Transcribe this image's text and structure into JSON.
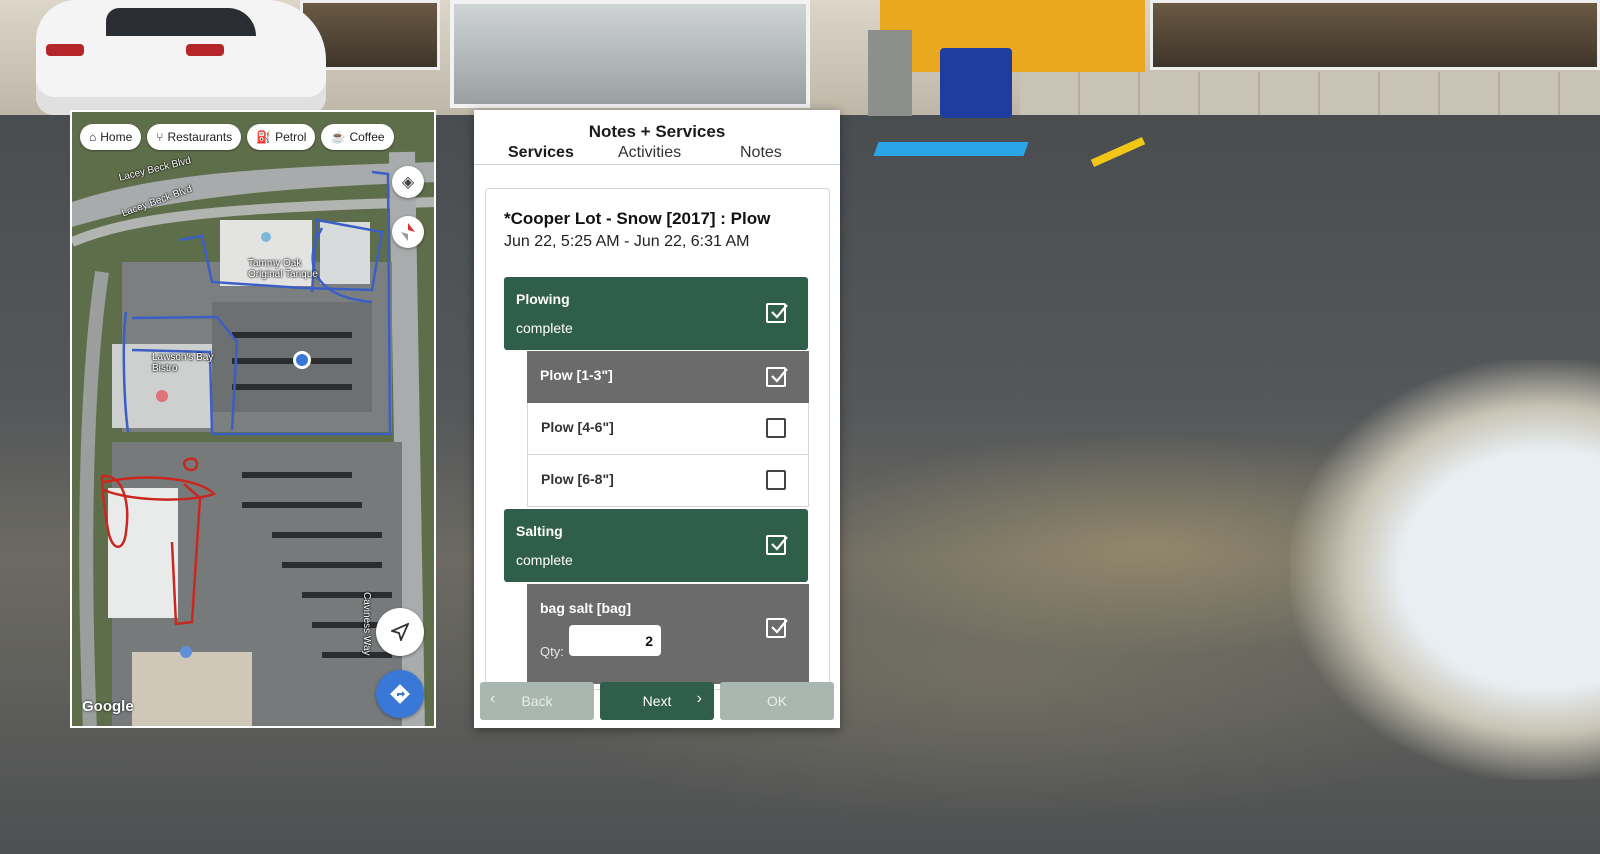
{
  "map": {
    "chips": [
      {
        "label": "Home",
        "icon": "home-icon"
      },
      {
        "label": "Restaurants",
        "icon": "fork-knife-icon"
      },
      {
        "label": "Petrol",
        "icon": "fuel-icon"
      },
      {
        "label": "Coffee",
        "icon": "coffee-icon"
      }
    ],
    "road_labels": [
      "Lacey Beck Blvd",
      "Lacey Beck Blvd",
      "Caviness Way"
    ],
    "place_labels": [
      "Tammy Oak Original Tanque",
      "Lawson's Bay Bistro"
    ],
    "logo": "Google",
    "colors": {
      "route_blue": "#3b5fc4",
      "route_red": "#c8281f",
      "nav_button": "#3a78d8"
    }
  },
  "app": {
    "title": "Notes + Services",
    "tabs": [
      "Services",
      "Activities",
      "Notes"
    ],
    "job": {
      "title": "*Cooper Lot - Snow [2017] : Plow",
      "time": "Jun 22, 5:25 AM - Jun 22, 6:31 AM"
    },
    "sections": [
      {
        "name": "Plowing",
        "status": "complete",
        "checked": true
      },
      {
        "name": "Salting",
        "status": "complete",
        "checked": true
      }
    ],
    "plow_items": [
      {
        "label": "Plow [1-3\"]",
        "checked": true
      },
      {
        "label": "Plow [4-6\"]",
        "checked": false
      },
      {
        "label": "Plow [6-8\"]",
        "checked": false
      }
    ],
    "salt_item": {
      "label": "bag salt [bag]",
      "qty_label": "Qty:",
      "qty_value": "2",
      "checked": true
    },
    "footer": {
      "back": "Back",
      "next": "Next",
      "ok": "OK"
    },
    "colors": {
      "primary_green": "#2f5f4b",
      "item_gray": "#6b6b6b",
      "disabled": "#a9b7b0"
    }
  }
}
